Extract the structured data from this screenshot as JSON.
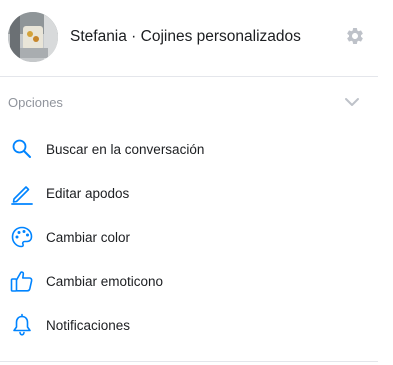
{
  "header": {
    "title": "Stefania · Cojines personalizados",
    "avatar_icon": "avatar-photo",
    "settings_icon": "gear-icon"
  },
  "section": {
    "label": "Opciones",
    "toggle_icon": "chevron-down-icon",
    "expanded": true
  },
  "menu": {
    "items": [
      {
        "label": "Buscar en la conversación",
        "icon": "search-icon"
      },
      {
        "label": "Editar apodos",
        "icon": "pencil-icon"
      },
      {
        "label": "Cambiar color",
        "icon": "palette-icon"
      },
      {
        "label": "Cambiar emoticono",
        "icon": "thumbs-up-icon"
      },
      {
        "label": "Notificaciones",
        "icon": "bell-icon"
      }
    ]
  },
  "colors": {
    "accent": "#0084ff",
    "muted_icon": "#bec2c9",
    "muted_text": "#90949c",
    "divider": "#e4e6eb"
  }
}
